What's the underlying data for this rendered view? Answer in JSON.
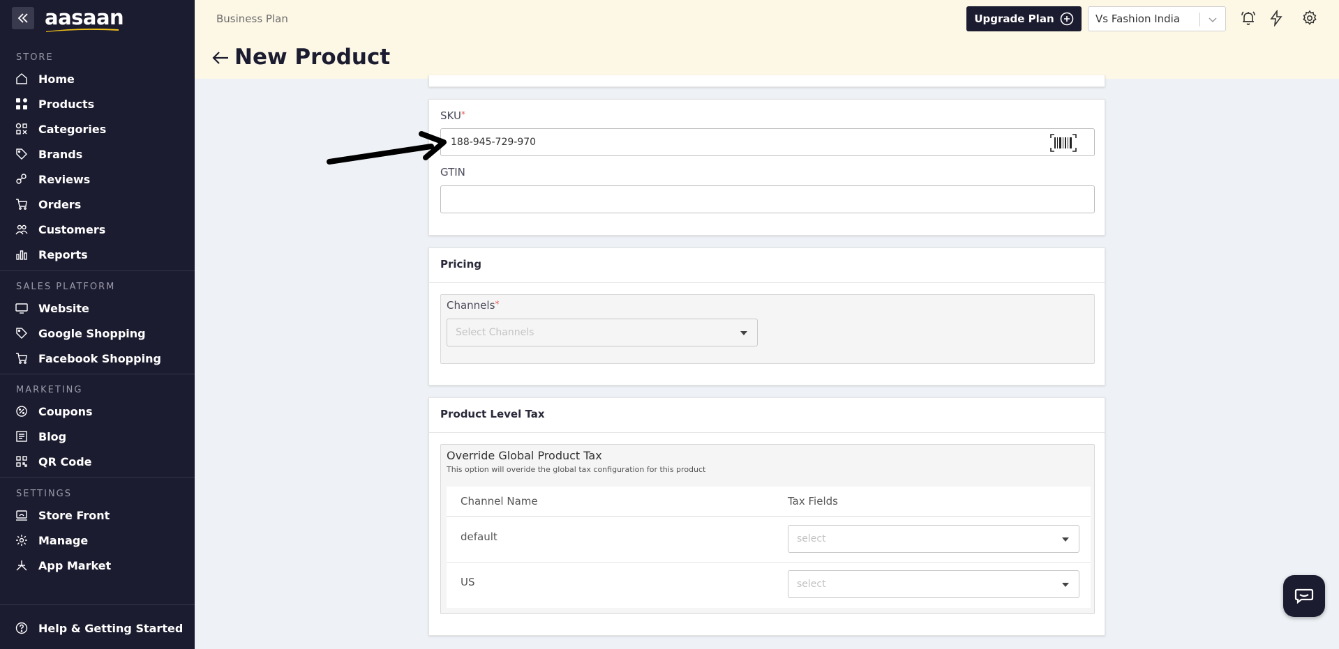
{
  "app": {
    "logo_text": "aasaan",
    "accent_color": "#f5c518"
  },
  "sidebar": {
    "sections": [
      {
        "title": "STORE",
        "items": [
          {
            "label": "Home",
            "icon": "home-icon"
          },
          {
            "label": "Products",
            "icon": "grid-icon"
          },
          {
            "label": "Categories",
            "icon": "categories-icon"
          },
          {
            "label": "Brands",
            "icon": "tag-icon"
          },
          {
            "label": "Reviews",
            "icon": "reviews-icon"
          },
          {
            "label": "Orders",
            "icon": "cart-icon"
          },
          {
            "label": "Customers",
            "icon": "users-icon"
          },
          {
            "label": "Reports",
            "icon": "bar-chart-icon"
          }
        ]
      },
      {
        "title": "SALES PLATFORM",
        "items": [
          {
            "label": "Website",
            "icon": "monitor-icon"
          },
          {
            "label": "Google Shopping",
            "icon": "tag-icon"
          },
          {
            "label": "Facebook Shopping",
            "icon": "cart-icon"
          }
        ]
      },
      {
        "title": "MARKETING",
        "items": [
          {
            "label": "Coupons",
            "icon": "coupon-icon"
          },
          {
            "label": "Blog",
            "icon": "blog-icon"
          },
          {
            "label": "QR Code",
            "icon": "qr-icon"
          }
        ]
      },
      {
        "title": "SETTINGS",
        "items": [
          {
            "label": "Store Front",
            "icon": "storefront-icon"
          },
          {
            "label": "Manage",
            "icon": "gear-icon"
          },
          {
            "label": "App Market",
            "icon": "app-market-icon"
          }
        ]
      }
    ],
    "help_label": "Help & Getting Started"
  },
  "header": {
    "plan_label": "Business Plan",
    "page_title": "New Product",
    "upgrade_label": "Upgrade Plan",
    "store_name": "Vs Fashion India"
  },
  "identifiers": {
    "sku_label": "SKU",
    "sku_value": "188-945-729-970",
    "gtin_label": "GTIN",
    "gtin_value": ""
  },
  "pricing": {
    "title": "Pricing",
    "channels_label": "Channels",
    "channels_placeholder": "Select Channels"
  },
  "tax": {
    "title": "Product Level Tax",
    "override_title": "Override Global Product Tax",
    "override_desc": "This option will overide the global tax configuration for this product",
    "columns": [
      "Channel Name",
      "Tax Fields"
    ],
    "rows": [
      {
        "channel": "default",
        "placeholder": "select"
      },
      {
        "channel": "US",
        "placeholder": "select"
      }
    ]
  }
}
